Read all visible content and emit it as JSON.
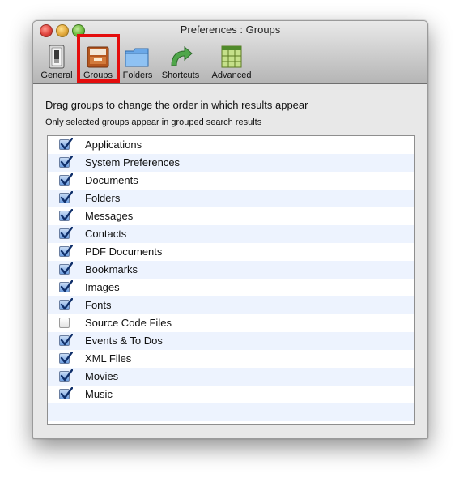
{
  "window": {
    "title": "Preferences : Groups"
  },
  "toolbar": {
    "items": [
      {
        "label": "General",
        "icon": "switch-icon"
      },
      {
        "label": "Groups",
        "icon": "inbox-tray-icon",
        "selected": true
      },
      {
        "label": "Folders",
        "icon": "folder-icon"
      },
      {
        "label": "Shortcuts",
        "icon": "curved-arrow-icon"
      },
      {
        "label": "Advanced",
        "icon": "grid-icon"
      }
    ]
  },
  "main": {
    "heading": "Drag groups to change the order in which results appear",
    "subheading": "Only selected groups appear in grouped search results",
    "groups": [
      {
        "label": "Applications",
        "checked": true
      },
      {
        "label": "System Preferences",
        "checked": true
      },
      {
        "label": "Documents",
        "checked": true
      },
      {
        "label": "Folders",
        "checked": true
      },
      {
        "label": "Messages",
        "checked": true
      },
      {
        "label": "Contacts",
        "checked": true
      },
      {
        "label": "PDF Documents",
        "checked": true
      },
      {
        "label": "Bookmarks",
        "checked": true
      },
      {
        "label": "Images",
        "checked": true
      },
      {
        "label": "Fonts",
        "checked": true
      },
      {
        "label": "Source Code Files",
        "checked": false
      },
      {
        "label": "Events & To Dos",
        "checked": true
      },
      {
        "label": "XML Files",
        "checked": true
      },
      {
        "label": "Movies",
        "checked": true
      },
      {
        "label": "Music",
        "checked": true
      }
    ]
  },
  "colors": {
    "highlight_ring": "#e40d0d",
    "row_alt": "#edf3fe",
    "checkbox_blue": "#6e9edf"
  }
}
